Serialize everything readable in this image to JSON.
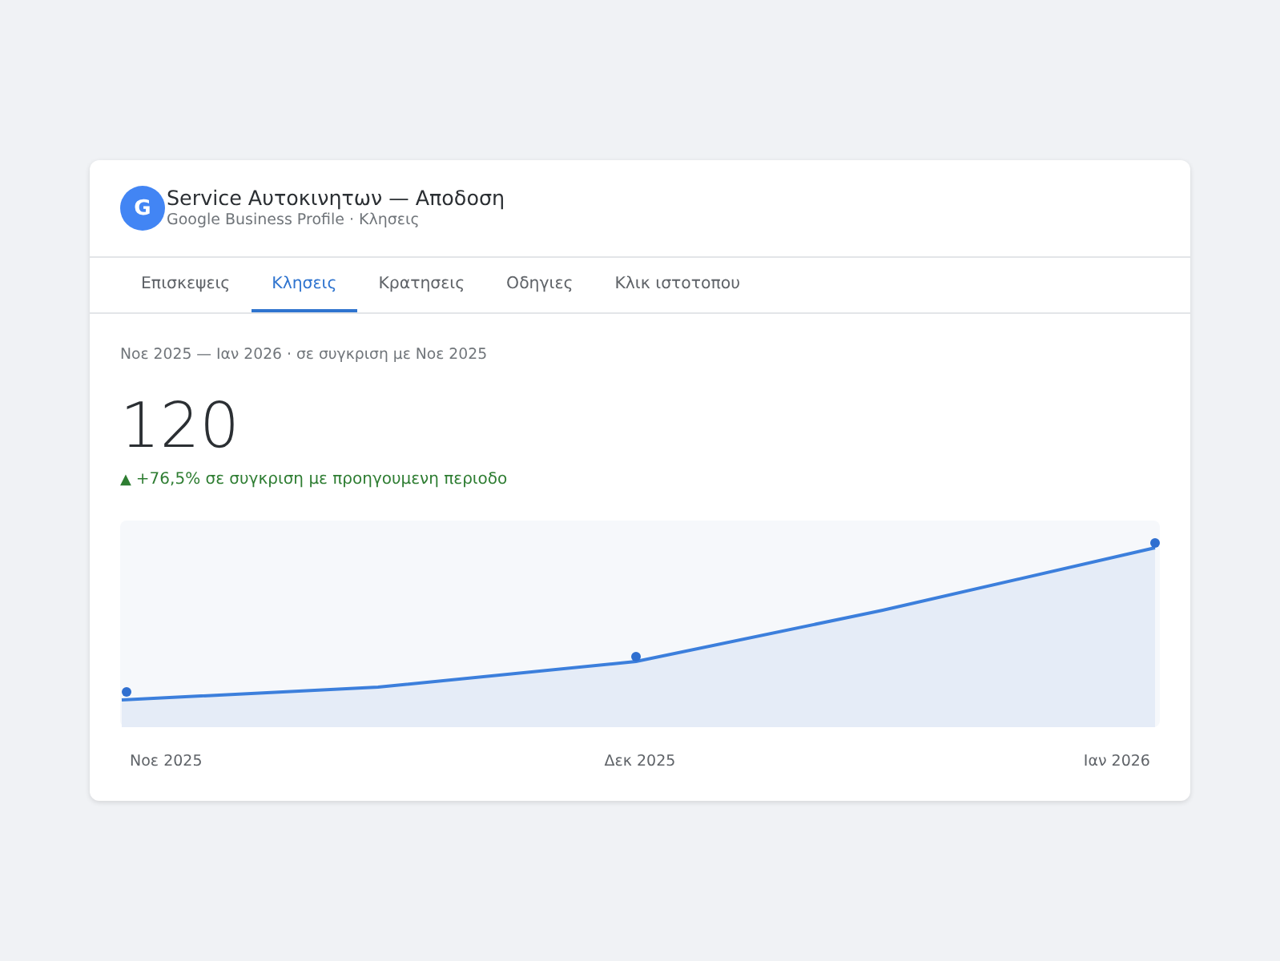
{
  "header": {
    "avatar_letter": "G",
    "title": "Service Αυτοκινητων — Αποδοση",
    "subtitle": "Google Business Profile · Κλησεις"
  },
  "tabs": [
    {
      "label": "Επισκεψεις",
      "selected": false
    },
    {
      "label": "Κλησεις",
      "selected": true
    },
    {
      "label": "Κρατησεις",
      "selected": false
    },
    {
      "label": "Οδηγιες",
      "selected": false
    },
    {
      "label": "Κλικ ιστοτοπου",
      "selected": false
    }
  ],
  "summary": {
    "period": "Νοε 2025 — Ιαν 2026 · σε συγκριση με Νοε 2025",
    "value": "120",
    "change": {
      "arrow": "▲",
      "text": "+76,5% σε συγκριση με προηγουμενη περιοδο"
    }
  },
  "chart": {
    "x_labels": [
      "Νοε 2025",
      "Δεκ 2025",
      "Ιαν 2026"
    ]
  }
}
